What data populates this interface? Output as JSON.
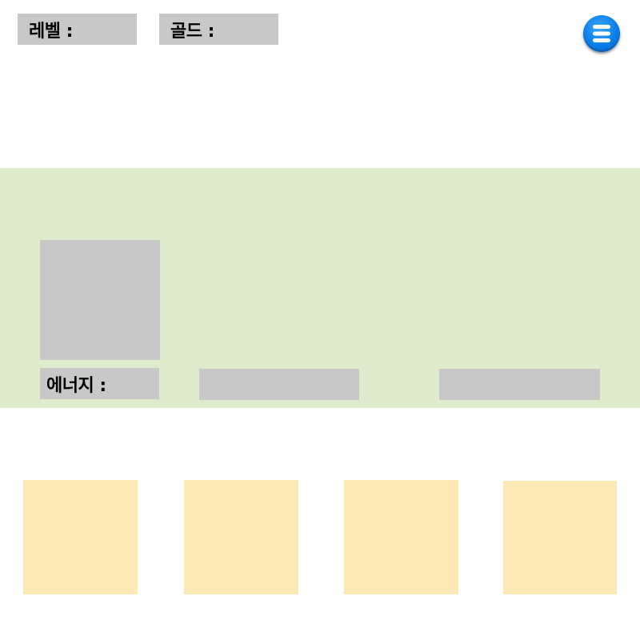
{
  "hud": {
    "level_label": "레벨 :",
    "gold_label": "골드 :"
  },
  "menu": {
    "icon": "menu-icon",
    "color": "#0a7ee8"
  },
  "character_panel": {
    "background": "#deebcc",
    "energy_label": "에너지 :"
  },
  "cards": {
    "count": 4,
    "color": "#fde9b6"
  }
}
